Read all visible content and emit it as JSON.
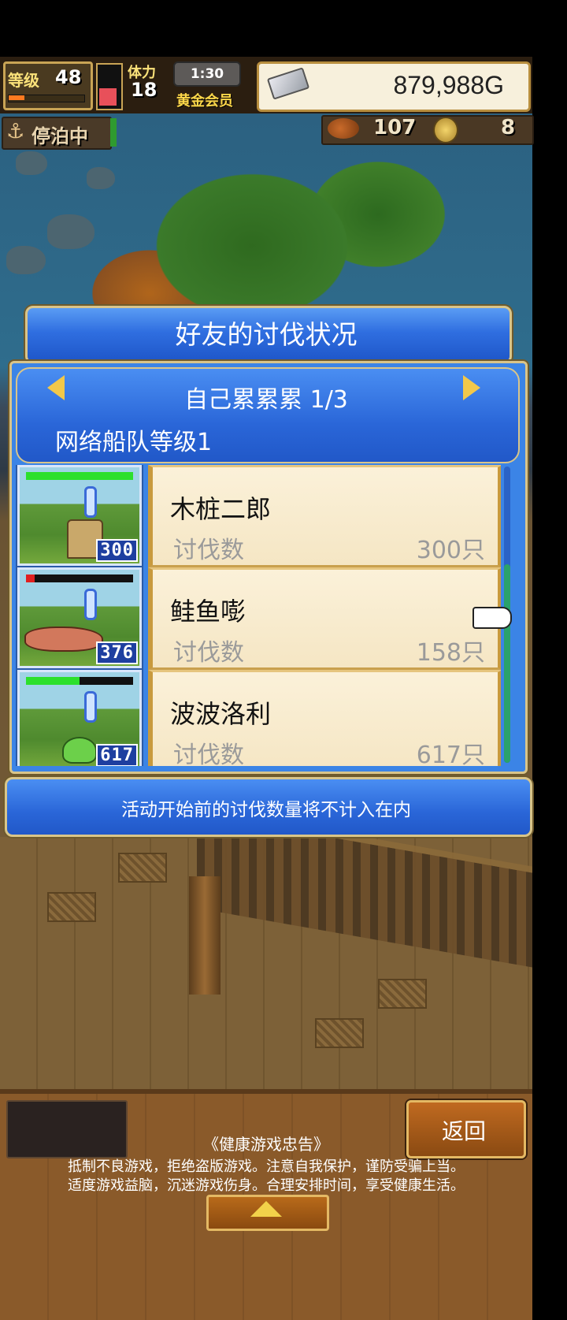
{
  "hud": {
    "level_label": "等级",
    "level": "48",
    "stamina_label": "体力",
    "stamina": "18",
    "time": "1:30",
    "membership": "黄金会员",
    "money": "879,988G",
    "dock_status": "停泊中",
    "food_count": "107",
    "coin_count": "8"
  },
  "modal": {
    "title": "好友的讨伐状况",
    "friend_name": "自己累累累 1/3",
    "fleet_level": "网络船队等级1",
    "notice": "活动开始前的讨伐数量将不计入在内",
    "entries": [
      {
        "name": "木桩二郎",
        "label": "讨伐数",
        "count": "300只",
        "badge": "300",
        "hp": 1.0,
        "hp_color": "#2ce02c"
      },
      {
        "name": "鲑鱼嘭",
        "label": "讨伐数",
        "count": "158只",
        "badge": "376",
        "hp": 0.08,
        "hp_color": "#e02020"
      },
      {
        "name": "波波洛利",
        "label": "讨伐数",
        "count": "617只",
        "badge": "617",
        "hp": 0.5,
        "hp_color": "#2ce02c"
      }
    ]
  },
  "footer": {
    "back_label": "返回",
    "health_title": "《健康游戏忠告》",
    "health_line1": "抵制不良游戏，拒绝盗版游戏。注意自我保护，谨防受骗上当。",
    "health_line2": "适度游戏益脑，沉迷游戏伤身。合理安排时间，享受健康生活。"
  },
  "icons": {
    "anchor": "anchor-icon",
    "money": "silver-bar-icon",
    "food": "meat-icon",
    "coin": "coin-icon",
    "prev": "arrow-left-icon",
    "next": "arrow-right-icon",
    "pointer": "pointing-hand-icon",
    "expand": "triangle-up-icon"
  }
}
